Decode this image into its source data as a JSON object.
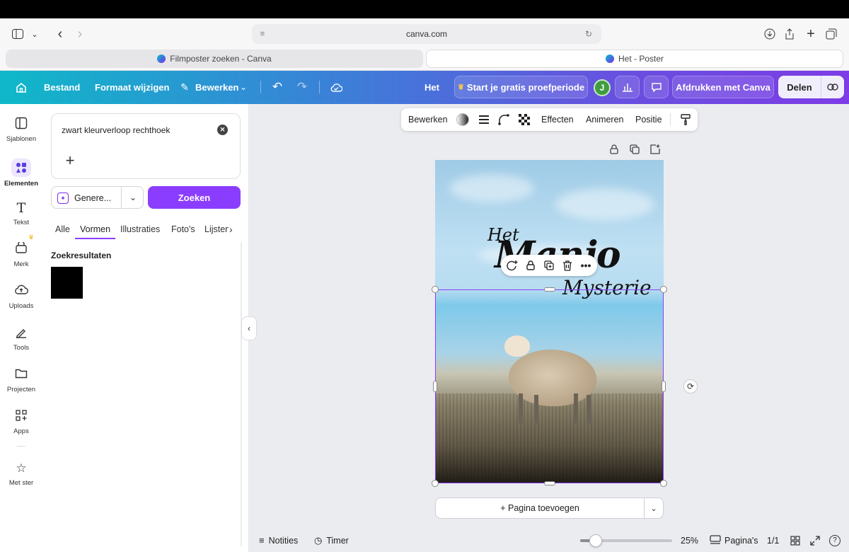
{
  "browser": {
    "url": "canva.com",
    "tabs": [
      {
        "label": "Filmposter zoeken - Canva",
        "active": false
      },
      {
        "label": "Het - Poster",
        "active": true
      }
    ]
  },
  "header": {
    "file_menu": "Bestand",
    "resize": "Formaat wijzigen",
    "edit_mode": "Bewerken",
    "design_title": "Het",
    "trial_button": "Start je gratis proefperiode",
    "trial_icon": "crown-icon",
    "avatar_initial": "J",
    "print_button": "Afdrukken met Canva",
    "share_button": "Delen"
  },
  "left_rail": {
    "items": [
      {
        "label": "Sjablonen",
        "icon": "templates-icon"
      },
      {
        "label": "Elementen",
        "icon": "elements-icon"
      },
      {
        "label": "Tekst",
        "icon": "text-icon"
      },
      {
        "label": "Merk",
        "icon": "brand-icon"
      },
      {
        "label": "Uploads",
        "icon": "upload-icon"
      },
      {
        "label": "Tools",
        "icon": "tools-icon"
      },
      {
        "label": "Projecten",
        "icon": "folder-icon"
      },
      {
        "label": "Apps",
        "icon": "apps-icon"
      },
      {
        "label": "Met ster",
        "icon": "star-icon"
      }
    ]
  },
  "side_panel": {
    "prompt_value": "zwart kleurverloop rechthoek",
    "generate_label": "Genere...",
    "search_button": "Zoeken",
    "filter_tabs": [
      "Alle",
      "Vormen",
      "Illustraties",
      "Foto's",
      "Lijsten"
    ],
    "active_tab": "Vormen",
    "results_title": "Zoekresultaten"
  },
  "context_toolbar": {
    "edit": "Bewerken",
    "effects": "Effecten",
    "animate": "Animeren",
    "position": "Positie"
  },
  "poster": {
    "title_small": "Het",
    "title_main": "Manjo",
    "title_sub": "Mysterie"
  },
  "add_page_button": "+ Pagina toevoegen",
  "bottom_bar": {
    "notes": "Notities",
    "timer": "Timer",
    "zoom_percent": 25,
    "zoom_label": "25%",
    "pages_label": "Pagina's",
    "page_count": "1/1"
  },
  "colors": {
    "accent": "#8b3dff",
    "header_start": "#0fb8c9",
    "header_end": "#7d3ce6"
  }
}
